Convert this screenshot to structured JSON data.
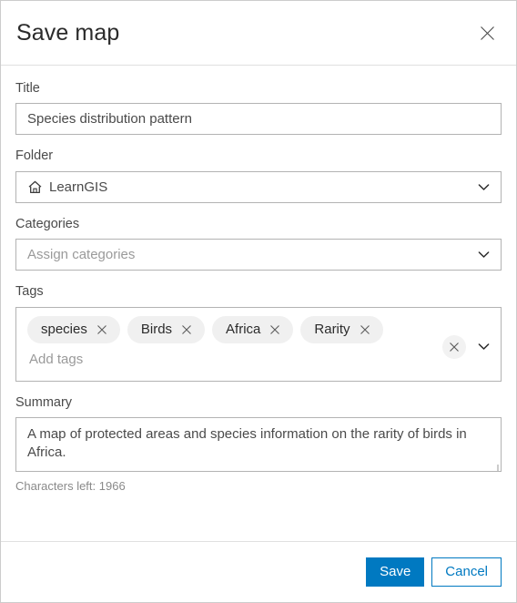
{
  "dialog": {
    "title": "Save map",
    "close_icon": "close-icon"
  },
  "fields": {
    "title": {
      "label": "Title",
      "value": "Species distribution pattern",
      "placeholder": "Title"
    },
    "folder": {
      "label": "Folder",
      "value": "LearnGIS",
      "icon": "home-icon",
      "chevron": "chevron-down-icon"
    },
    "categories": {
      "label": "Categories",
      "value": "",
      "placeholder": "Assign categories",
      "chevron": "chevron-down-icon"
    },
    "tags": {
      "label": "Tags",
      "chips": [
        {
          "label": "species",
          "remove_icon": "close-icon"
        },
        {
          "label": "Birds",
          "remove_icon": "close-icon"
        },
        {
          "label": "Africa",
          "remove_icon": "close-icon"
        },
        {
          "label": "Rarity",
          "remove_icon": "close-icon"
        }
      ],
      "input_placeholder": "Add tags",
      "clear_icon": "close-icon",
      "chevron": "chevron-down-icon"
    },
    "summary": {
      "label": "Summary",
      "value": "A map of protected areas and species information on the rarity of birds in Africa.",
      "characters_left": "Characters left: 1966"
    }
  },
  "footer": {
    "save_label": "Save",
    "cancel_label": "Cancel"
  },
  "colors": {
    "accent": "#0079c1",
    "border": "#b3b3b3",
    "chip_bg": "#f0f0f0",
    "text": "#4a4a4a",
    "placeholder": "#9a9a9a"
  }
}
